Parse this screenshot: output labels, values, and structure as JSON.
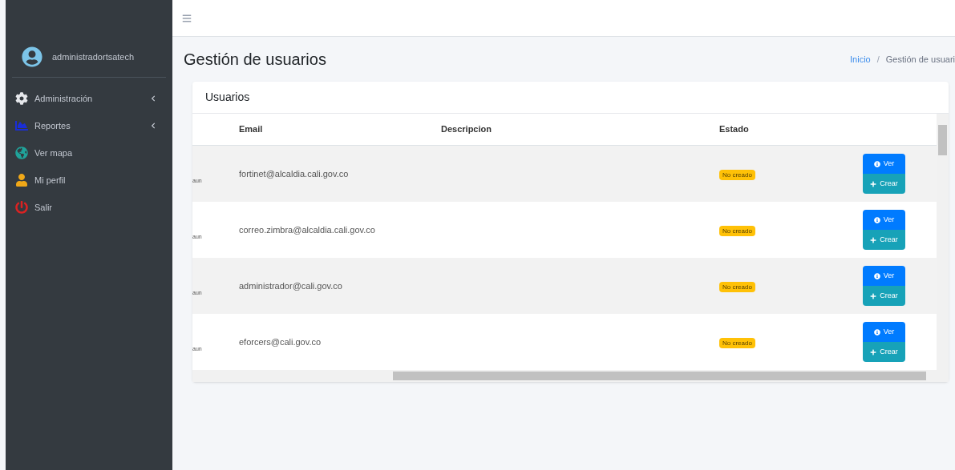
{
  "sidebar": {
    "user": "administradortsatech",
    "items": [
      {
        "kind": "gear",
        "label": "Administración",
        "expandable": true
      },
      {
        "kind": "chart",
        "label": "Reportes",
        "expandable": true
      },
      {
        "kind": "globe",
        "label": "Ver mapa",
        "expandable": false
      },
      {
        "kind": "person",
        "label": "Mi perfil",
        "expandable": false
      },
      {
        "kind": "power",
        "label": "Salir",
        "expandable": false
      }
    ]
  },
  "page": {
    "title": "Gestión de usuarios",
    "breadcrumb_separator": "/",
    "breadcrumb": [
      {
        "label": "Inicio",
        "link": true
      },
      {
        "label": "Gestión de usuari",
        "link": false
      }
    ]
  },
  "card": {
    "title": "Usuarios",
    "table": {
      "columns": [
        "Email",
        "Descripcion",
        "Estado"
      ],
      "rows": [
        {
          "column_1": "aun",
          "email": "fortinet@alcaldia.cali.gov.co",
          "estado": "No creado",
          "actions": [
            "Ver",
            "Crear"
          ]
        },
        {
          "column_1": "aun",
          "email": "correo.zimbra@alcaldia.cali.gov.co",
          "estado": "No creado",
          "actions": [
            "Ver",
            "Crear"
          ]
        },
        {
          "column_1": "aun",
          "email": "administrador@cali.gov.co",
          "estado": "No creado",
          "actions": [
            "Ver",
            "Crear"
          ]
        },
        {
          "column_1": "aun",
          "email": "eforcers@cali.gov.co",
          "estado": "No creado",
          "actions": [
            "Ver",
            "Crear"
          ]
        }
      ]
    }
  }
}
